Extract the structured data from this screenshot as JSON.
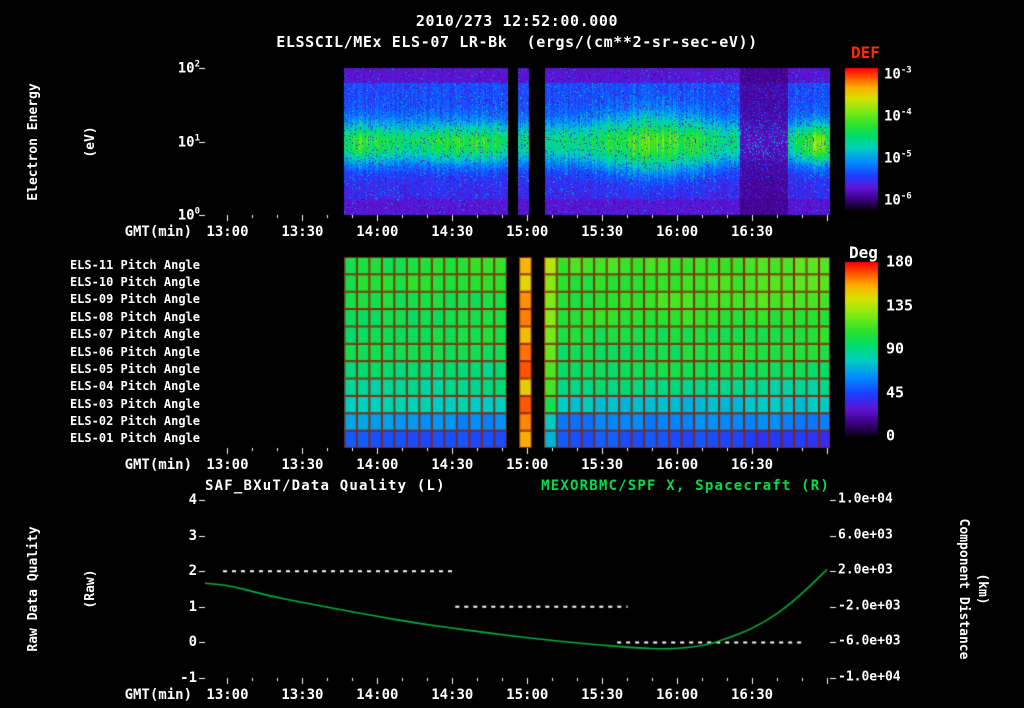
{
  "header": {
    "title": "2010/273 12:52:00.000",
    "subtitle": "ELSSCIL/MEx ELS-07 LR-Bk  (ergs/(cm**2-sr-sec-eV))"
  },
  "colors": {
    "background": "#000000",
    "text": "#ffffff",
    "def_title": "#ff2a00",
    "right_title_green": "#00dd44",
    "curve_green": "#00b03a",
    "dashed_white": "#ffffff",
    "pitch_grid": "#8a2400",
    "colormap": [
      {
        "v": 0.0,
        "c": [
          8,
          0,
          20
        ]
      },
      {
        "v": 0.08,
        "c": [
          60,
          0,
          130
        ]
      },
      {
        "v": 0.16,
        "c": [
          96,
          20,
          214
        ]
      },
      {
        "v": 0.24,
        "c": [
          30,
          60,
          255
        ]
      },
      {
        "v": 0.34,
        "c": [
          0,
          140,
          255
        ]
      },
      {
        "v": 0.44,
        "c": [
          0,
          208,
          192
        ]
      },
      {
        "v": 0.52,
        "c": [
          0,
          220,
          110
        ]
      },
      {
        "v": 0.6,
        "c": [
          40,
          226,
          46
        ]
      },
      {
        "v": 0.7,
        "c": [
          130,
          235,
          20
        ]
      },
      {
        "v": 0.79,
        "c": [
          215,
          226,
          0
        ]
      },
      {
        "v": 0.87,
        "c": [
          255,
          170,
          0
        ]
      },
      {
        "v": 0.94,
        "c": [
          255,
          80,
          0
        ]
      },
      {
        "v": 1.0,
        "c": [
          255,
          0,
          0
        ]
      }
    ]
  },
  "time_axis": {
    "label": "GMT(min)",
    "tick_labels": [
      "13:00",
      "13:30",
      "14:00",
      "14:30",
      "15:00",
      "15:30",
      "16:00",
      "16:30"
    ],
    "tick_hours": [
      13.0,
      13.5,
      14.0,
      14.5,
      15.0,
      15.5,
      16.0,
      16.5
    ],
    "domain_hours": [
      12.85,
      17.02
    ]
  },
  "spectrogram_panel": {
    "y_label_lines": [
      "Electron Energy",
      "(eV)"
    ],
    "y_ticks": [
      {
        "base": "10",
        "exp": "2",
        "log_value": 2
      },
      {
        "base": "10",
        "exp": "1",
        "log_value": 1
      },
      {
        "base": "10",
        "exp": "0",
        "log_value": 0
      }
    ],
    "colorbar": {
      "title": "DEF",
      "ticks": [
        {
          "base": "10",
          "exp": "-3"
        },
        {
          "base": "10",
          "exp": "-4"
        },
        {
          "base": "10",
          "exp": "-5"
        },
        {
          "base": "10",
          "exp": "-6"
        }
      ]
    }
  },
  "pitch_panel": {
    "row_labels": [
      "ELS-11 Pitch Angle",
      "ELS-10 Pitch Angle",
      "ELS-09 Pitch Angle",
      "ELS-08 Pitch Angle",
      "ELS-07 Pitch Angle",
      "ELS-06 Pitch Angle",
      "ELS-05 Pitch Angle",
      "ELS-04 Pitch Angle",
      "ELS-03 Pitch Angle",
      "ELS-02 Pitch Angle",
      "ELS-01 Pitch Angle"
    ],
    "colorbar": {
      "title": "Deg",
      "ticks": [
        "180",
        "135",
        "90",
        "45",
        "0"
      ]
    }
  },
  "quality_panel": {
    "title_left": "SAF_BXuT/Data Quality (L)",
    "title_right": "MEXORBMC/SPF X, Spacecraft (R)",
    "y_label_left_lines": [
      "Raw Data Quality",
      "(Raw)"
    ],
    "y_label_right_lines": [
      "Component Distance",
      "(km)"
    ],
    "left_ticks": [
      "4",
      "3",
      "2",
      "1",
      "0",
      "-1"
    ],
    "right_ticks": [
      "1.0e+04",
      "6.0e+03",
      "2.0e+03",
      "-2.0e+03",
      "-6.0e+03",
      "-1.0e+04"
    ]
  },
  "chart_data": [
    {
      "type": "heatmap",
      "name": "electron_energy_spectrogram",
      "title": "ELSSCIL/MEx ELS-07 LR-Bk",
      "units": "ergs/(cm**2-sr-sec-eV)",
      "x_label": "GMT(min)",
      "x_tick_labels": [
        "13:00",
        "13:30",
        "14:00",
        "14:30",
        "15:00",
        "15:30",
        "16:00",
        "16:30"
      ],
      "y_label": "Electron Energy (eV)",
      "y_scale": "log",
      "y_range_eV": [
        1,
        100
      ],
      "color_scale": "log",
      "color_range": [
        1e-06,
        0.001
      ],
      "data_start_hour": 13.78,
      "data_end_hour": 17.02,
      "data_gaps_hours": [
        [
          14.87,
          14.94
        ],
        [
          15.01,
          15.12
        ]
      ],
      "low_flux_hours": [
        16.42,
        16.74
      ],
      "band_center_eV": 9.3,
      "band_center_log": 0.97,
      "band_width_decades": 0.2,
      "enhancements": [
        {
          "center_hour": 13.87,
          "sigma_hours": 0.08,
          "amp": 0.1
        },
        {
          "center_hour": 14.0,
          "sigma_hours": 0.12,
          "amp": 0.1
        },
        {
          "center_hour": 14.6,
          "sigma_hours": 0.18,
          "amp": 0.14
        },
        {
          "center_hour": 15.85,
          "sigma_hours": 0.25,
          "amp": 0.2
        },
        {
          "center_hour": 16.93,
          "sigma_hours": 0.07,
          "amp": 0.28
        }
      ]
    },
    {
      "type": "heatmap",
      "name": "pitch_angles",
      "rows_top_to_bottom": [
        "ELS-11",
        "ELS-10",
        "ELS-09",
        "ELS-08",
        "ELS-07",
        "ELS-06",
        "ELS-05",
        "ELS-04",
        "ELS-03",
        "ELS-02",
        "ELS-01"
      ],
      "units": "deg",
      "value_range": [
        0,
        180
      ],
      "cell_minutes": 5,
      "data_start_hour": 13.78,
      "gaps_hours": [
        [
          14.87,
          14.94
        ],
        [
          15.01,
          15.12
        ]
      ],
      "hot_interval_hours": [
        14.94,
        15.01
      ],
      "hot_angle_deg": 150,
      "row_base_angles_deg": [
        102,
        101,
        100,
        99,
        97,
        95,
        92,
        87,
        78,
        64,
        52
      ],
      "row_drift_deg": [
        16,
        15,
        14,
        12,
        10,
        8,
        5,
        2,
        -3,
        -7,
        -10
      ]
    },
    {
      "type": "line",
      "x_label": "GMT(min)",
      "left_axis": {
        "label": "Raw Data Quality (Raw)",
        "range": [
          -1,
          4
        ]
      },
      "right_axis": {
        "label": "Component Distance (km)",
        "range": [
          -10000,
          10000
        ]
      },
      "series": [
        {
          "name": "SAF_BXuT/Data Quality (L)",
          "axis": "left",
          "style": "dashed",
          "color": "#ffffff",
          "segments": [
            {
              "value": 2,
              "start_hour": 12.97,
              "end_hour": 14.5
            },
            {
              "value": 1,
              "start_hour": 14.52,
              "end_hour": 15.67
            },
            {
              "value": 0,
              "start_hour": 15.6,
              "end_hour": 16.85
            }
          ]
        },
        {
          "name": "MEXORBMC/SPF X, Spacecraft (R)",
          "axis": "right",
          "style": "solid",
          "color": "#00b03a",
          "x_hours": [
            12.85,
            13.0,
            13.25,
            13.5,
            13.75,
            14.0,
            14.25,
            14.5,
            14.75,
            15.0,
            15.25,
            15.5,
            15.75,
            15.9,
            16.0,
            16.17,
            16.33,
            16.5,
            16.67,
            16.83,
            17.0
          ],
          "values_km": [
            640,
            480,
            -680,
            -1520,
            -2320,
            -3080,
            -3800,
            -4400,
            -4960,
            -5480,
            -5920,
            -6320,
            -6640,
            -6720,
            -6680,
            -6400,
            -5600,
            -4480,
            -2800,
            -600,
            2200
          ]
        }
      ]
    }
  ]
}
